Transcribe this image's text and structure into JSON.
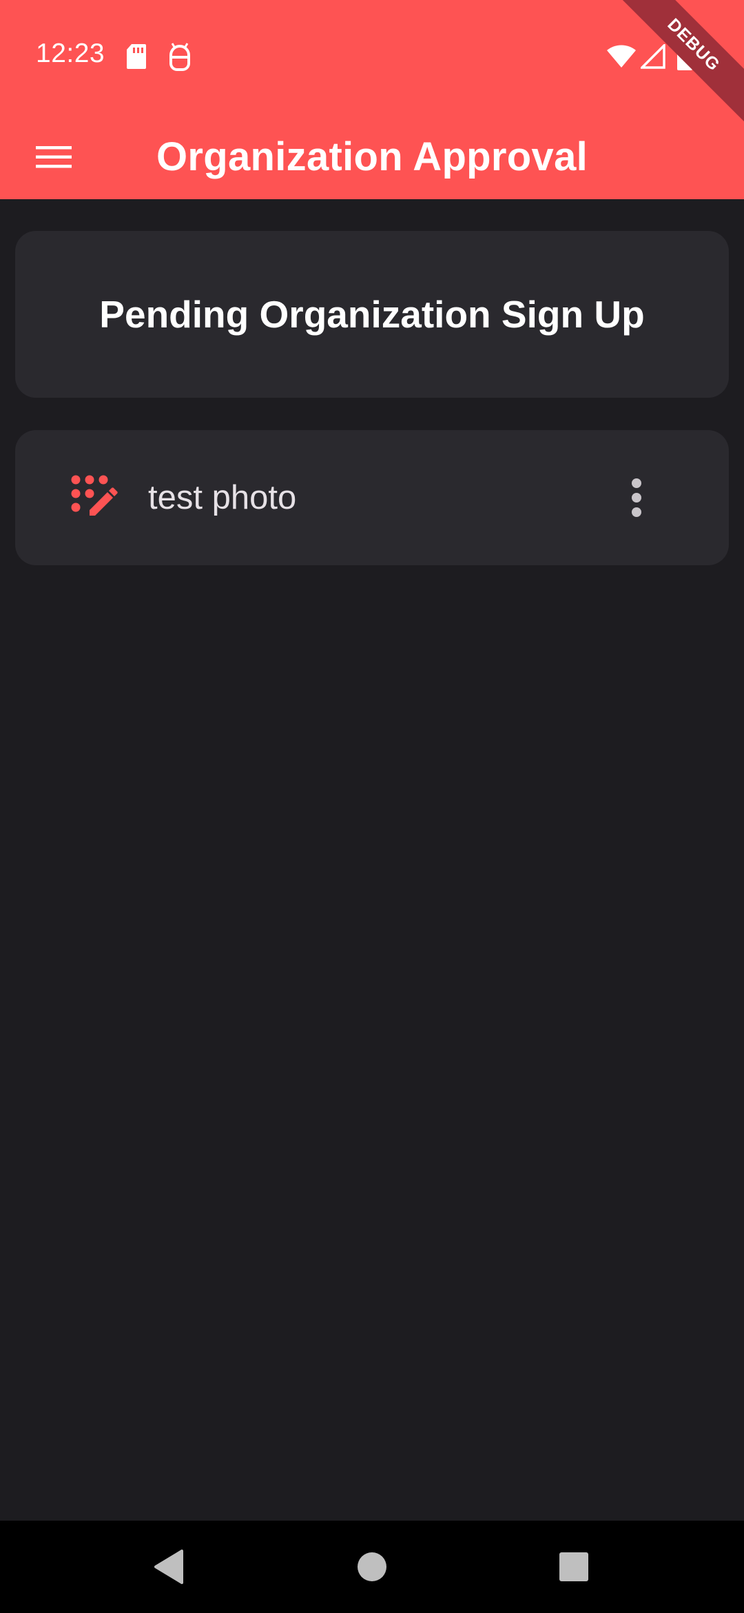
{
  "status_bar": {
    "time": "12:23"
  },
  "app_bar": {
    "title": "Organization Approval",
    "menu_icon": "hamburger-menu-icon"
  },
  "debug_banner": "DEBUG",
  "pending_card": {
    "title": "Pending Organization Sign Up"
  },
  "pending_list": [
    {
      "label": "test photo",
      "icon": "draw-dots-pencil-icon",
      "menu_icon": "more-vertical-icon"
    }
  ],
  "navigation": {
    "back": "back-triangle-icon",
    "home": "home-circle-icon",
    "recents": "recents-square-icon"
  },
  "colors": {
    "primary": "#fe5353",
    "background": "#1d1c20",
    "card": "#2a292e",
    "ribbon": "#a0303a"
  }
}
